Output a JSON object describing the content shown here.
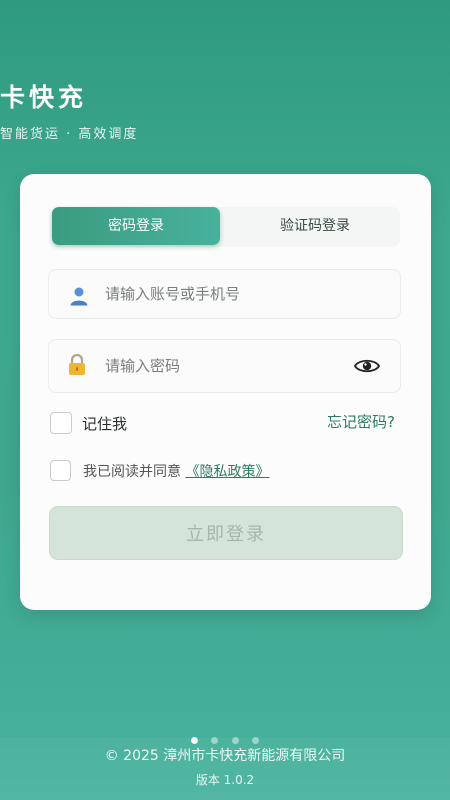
{
  "header": {
    "title": "卡快充",
    "subtitle": "智能货运 · 高效调度"
  },
  "login": {
    "tabs": [
      {
        "label": "密码登录",
        "active": true
      },
      {
        "label": "验证码登录",
        "active": false
      }
    ],
    "account_placeholder": "请输入账号或手机号",
    "password_placeholder": "请输入密码",
    "remember_label": "记住我",
    "forgot_label": "忘记密码?",
    "agree_prefix": "我已阅读并同意",
    "agree_link": "《隐私政策》",
    "submit_label": "立即登录",
    "icons": {
      "account": "user-icon",
      "password": "lock-icon",
      "visibility": "eye-icon"
    }
  },
  "pager": {
    "total": 4,
    "active": 0
  },
  "footer": {
    "copyright": "© 2025 漳州市卡快充新能源有限公司",
    "version": "版本 1.0.2"
  },
  "colors": {
    "brand": "#3a9c80",
    "link": "#2e7b62",
    "button_disabled": "#d5e4da"
  }
}
